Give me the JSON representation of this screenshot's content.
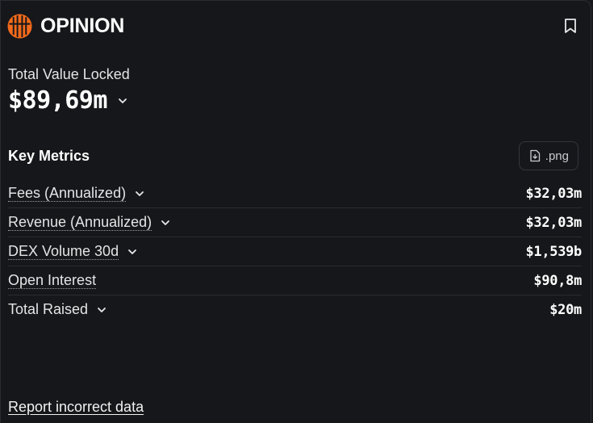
{
  "protocol": {
    "name": "OPINION",
    "logo_icon": "opinion-logo-icon",
    "brand_color": "#f26a1b"
  },
  "tvl": {
    "label": "Total Value Locked",
    "value": "$89,69m"
  },
  "key_metrics": {
    "title": "Key Metrics",
    "export_label": ".png",
    "rows": [
      {
        "label": "Fees (Annualized)",
        "value": "$32,03m",
        "dotted": true,
        "dropdown": true
      },
      {
        "label": "Revenue (Annualized)",
        "value": "$32,03m",
        "dotted": true,
        "dropdown": true
      },
      {
        "label": "DEX Volume 30d",
        "value": "$1,539b",
        "dotted": true,
        "dropdown": true
      },
      {
        "label": "Open Interest",
        "value": "$90,8m",
        "dotted": true,
        "dropdown": false
      },
      {
        "label": "Total Raised",
        "value": "$20m",
        "dotted": false,
        "dropdown": true
      }
    ]
  },
  "footer": {
    "report_link": "Report incorrect data"
  }
}
